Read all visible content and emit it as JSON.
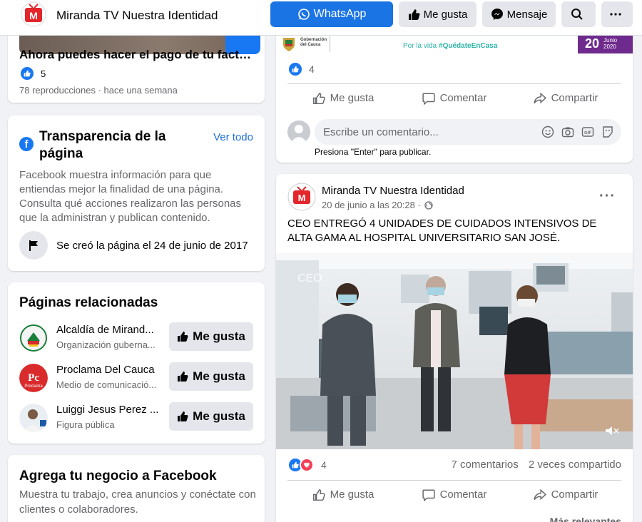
{
  "topbar": {
    "page_name": "Miranda TV Nuestra Identidad",
    "whatsapp_label": "WhatsApp",
    "like_label": "Me gusta",
    "message_label": "Mensaje"
  },
  "colors": {
    "brand": "#1877f2",
    "accent_blue": "#1b74e4",
    "logo_red": "#e3262b"
  },
  "left": {
    "video": {
      "title": "Ahora puedes hacer el pago de tu factur...",
      "likes": "5",
      "meta": "78 reproducciones · hace una semana"
    },
    "transparency": {
      "title": "Transparencia de la página",
      "see_all": "Ver todo",
      "description": "Facebook muestra información para que entiendas mejor la finalidad de una página. Consulta qué acciones realizaron las personas que la administran y publican contenido.",
      "created": "Se creó la página el 24 de junio de 2017"
    },
    "related": {
      "title": "Páginas relacionadas",
      "button_label": "Me gusta",
      "items": [
        {
          "name": "Alcaldía de Mirand...",
          "sub": "Organización guberna..."
        },
        {
          "name": "Proclama Del Cauca",
          "sub": "Medio de comunicació...",
          "logo_text": "Pc",
          "logo_caption": "Proclama"
        },
        {
          "name": "Luiggi Jesus Perez ...",
          "sub": "Figura pública"
        }
      ]
    },
    "business": {
      "title": "Agrega tu negocio a Facebook",
      "description": "Muestra tu trabajo, crea anuncios y conéctate con clientes o colaboradores."
    }
  },
  "post1": {
    "banner": {
      "gob_text_1": "Gobernación",
      "gob_text_2": "del Cauca",
      "stay_prefix": "Por la vida ",
      "stay_tag": "#QuédateEnCasa",
      "day": "20",
      "month": "Junio",
      "year": "2020"
    },
    "likes": "4",
    "actions": {
      "like": "Me gusta",
      "comment": "Comentar",
      "share": "Compartir"
    },
    "comment_placeholder": "Escribe un comentario...",
    "enter_hint": "Presiona \"Enter\" para publicar."
  },
  "post2": {
    "author": "Miranda TV Nuestra Identidad",
    "time": "20 de junio a las 20:28 ·",
    "text": "CEO ENTREGÓ 4 UNIDADES DE CUIDADOS INTENSIVOS DE ALTA GAMA  AL HOSPITAL UNIVERSITARIO SAN JOSÉ.",
    "photo_watermark": "CEO",
    "reactions": "4",
    "comments": "7 comentarios",
    "shares": "2 veces compartido",
    "actions": {
      "like": "Me gusta",
      "comment": "Comentar",
      "share": "Compartir"
    },
    "relevant": "Más relevantes"
  }
}
